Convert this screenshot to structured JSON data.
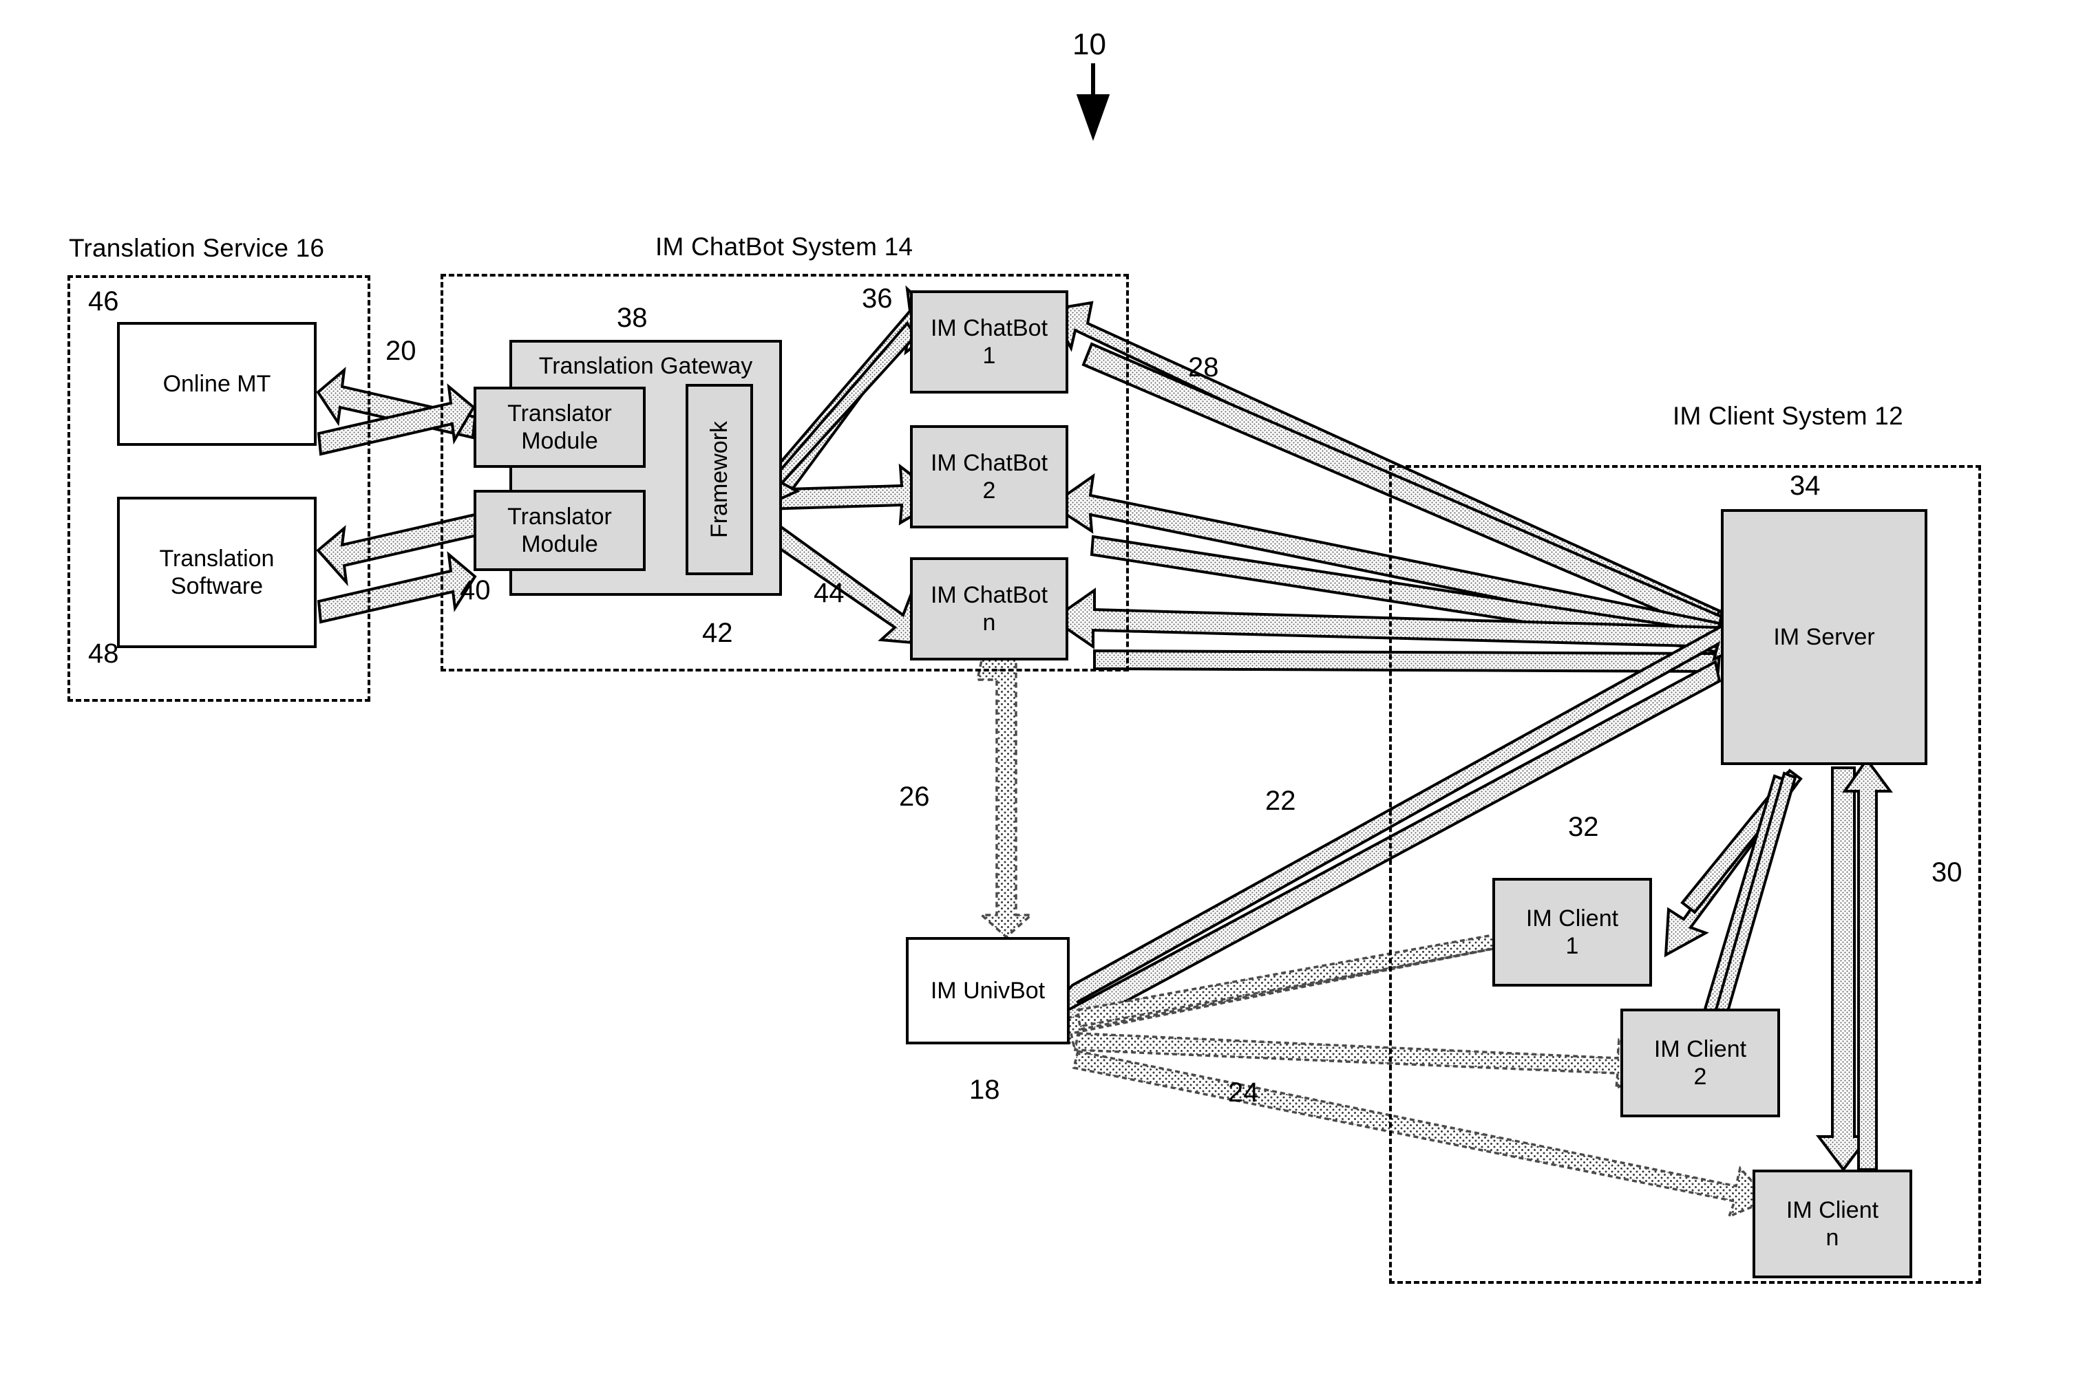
{
  "figure": {
    "reference_numeral": "10"
  },
  "groups": [
    {
      "id": "translation-service",
      "title": "Translation Service 16"
    },
    {
      "id": "im-chatbot-system",
      "title": "IM ChatBot System 14"
    },
    {
      "id": "im-client-system",
      "title": "IM Client System 12"
    }
  ],
  "boxes": {
    "online_mt": "Online MT",
    "translation_software_line1": "Translation",
    "translation_software_line2": "Software",
    "translation_gateway": "Translation Gateway",
    "translator_module_1_line1": "Translator",
    "translator_module_1_line2": "Module",
    "translator_module_2_line1": "Translator",
    "translator_module_2_line2": "Module",
    "framework": "Framework",
    "im_chatbot_1_line1": "IM ChatBot",
    "im_chatbot_1_line2": "1",
    "im_chatbot_2_line1": "IM ChatBot",
    "im_chatbot_2_line2": "2",
    "im_chatbot_n_line1": "IM ChatBot",
    "im_chatbot_n_line2": "n",
    "im_univbot": "IM UnivBot",
    "im_server": "IM Server",
    "im_client_1_line1": "IM Client",
    "im_client_1_line2": "1",
    "im_client_2_line1": "IM Client",
    "im_client_2_line2": "2",
    "im_client_n_line1": "IM Client",
    "im_client_n_line2": "n"
  },
  "reference_numerals": {
    "n46": "46",
    "n48": "48",
    "n20": "20",
    "n38": "38",
    "n40": "40",
    "n42": "42",
    "n36": "36",
    "n44": "44",
    "n28": "28",
    "n26": "26",
    "n18": "18",
    "n22": "22",
    "n24": "24",
    "n34": "34",
    "n32": "32",
    "n30": "30"
  },
  "colors": {
    "stroke": "#000000",
    "shaded_fill": "#d9d9d9",
    "gateway_fill": "#dcdcdc",
    "background": "#ffffff"
  }
}
